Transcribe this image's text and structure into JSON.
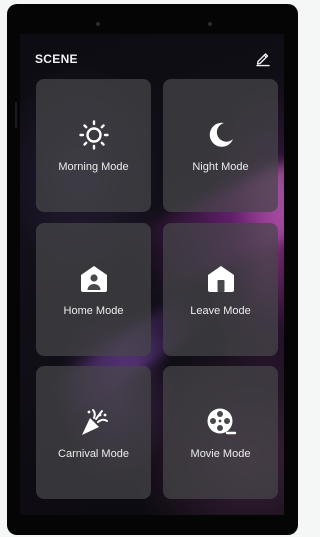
{
  "header": {
    "title": "SCENE",
    "edit_icon": "pencil-edit-icon"
  },
  "scenes": [
    {
      "label": "Morning Mode",
      "icon": "sun-icon"
    },
    {
      "label": "Night Mode",
      "icon": "moon-icon"
    },
    {
      "label": "Home Mode",
      "icon": "home-person-icon"
    },
    {
      "label": "Leave Mode",
      "icon": "house-door-icon"
    },
    {
      "label": "Carnival Mode",
      "icon": "party-popper-icon"
    },
    {
      "label": "Movie Mode",
      "icon": "film-reel-icon"
    }
  ],
  "colors": {
    "tile": "#46464a",
    "text": "#ececec",
    "background": "#0d0c12",
    "accent": "#b44fb0"
  }
}
